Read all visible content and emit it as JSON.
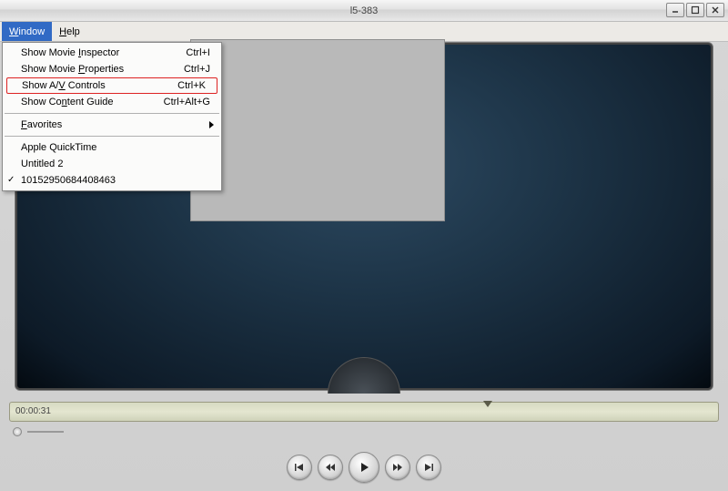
{
  "titlebar": {
    "title": "l5-383"
  },
  "menubar": {
    "window": "Window",
    "help": "Help",
    "window_u": "W",
    "help_u": "H"
  },
  "dropdown": {
    "items": [
      {
        "label": "Show Movie Inspector",
        "u": "I",
        "pre": "Show Movie ",
        "post": "nspector",
        "shortcut": "Ctrl+I"
      },
      {
        "label": "Show Movie Properties",
        "u": "P",
        "pre": "Show Movie  ",
        "post": "roperties",
        "shortcut": "Ctrl+J"
      },
      {
        "label": "Show A/V Controls",
        "u": "V",
        "pre": "Show A/",
        "post": " Controls",
        "shortcut": "Ctrl+K",
        "highlight": true
      },
      {
        "label": "Show Content Guide",
        "u": "n",
        "pre": "Show Co",
        "post": "tent Guide",
        "shortcut": "Ctrl+Alt+G"
      }
    ],
    "favorites": {
      "pre": "",
      "u": "F",
      "post": "avorites"
    },
    "windows": [
      {
        "label": "Apple QuickTime",
        "checked": false
      },
      {
        "label": "Untitled 2",
        "checked": false
      },
      {
        "label": "10152950684408463",
        "checked": true
      }
    ]
  },
  "player": {
    "time": "00:00:31"
  }
}
